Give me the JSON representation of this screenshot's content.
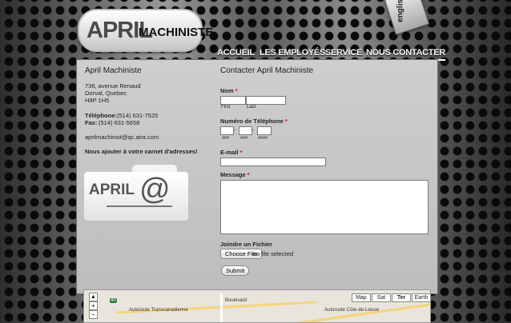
{
  "header": {
    "logo_main": "APRIL",
    "logo_sub": "MACHINISTE",
    "lang_toggle": "english?",
    "nav": [
      "ACCUEIL",
      "LES EMPLOYÉS",
      "SERVICE",
      "NOUS CONTACTER"
    ]
  },
  "contact": {
    "name": "April Machiniste",
    "address_lines": [
      "736, avenue Renaud",
      "Dorval, Quebec",
      "H9P 1H5"
    ],
    "phone_label": "Téléphone:",
    "phone": "(514) 631-7525",
    "fax_label": "Fax:",
    "fax": "(514) 631-5658",
    "email": "aprilmachinist@qc.aira.com",
    "addressbook": "Nous ajouter à votre carnet d'adresses!",
    "card_word": "APRIL",
    "card_symbol": "@"
  },
  "form": {
    "title": "Contacter April Machiniste",
    "name_label": "Nom",
    "first_label": "First",
    "last_label": "Last",
    "phone_label": "Numéro de Téléphone",
    "phone_hints": [
      "###",
      "###",
      "####"
    ],
    "phone_sep": "-",
    "email_label": "E-mail",
    "message_label": "Message",
    "required_mark": "*",
    "attach_label": "Joindre un Fichier",
    "choose_file": "Choose File",
    "no_file": "no file selected",
    "submit": "Submit"
  },
  "map": {
    "buttons": [
      "Map",
      "Sat",
      "Ter",
      "Earth"
    ],
    "selected": "Ter",
    "labels": [
      "Autoroute Transcanadienne",
      "Boulevard",
      "Autoroute Côte-de-Liesse"
    ],
    "route_badge": "40"
  }
}
